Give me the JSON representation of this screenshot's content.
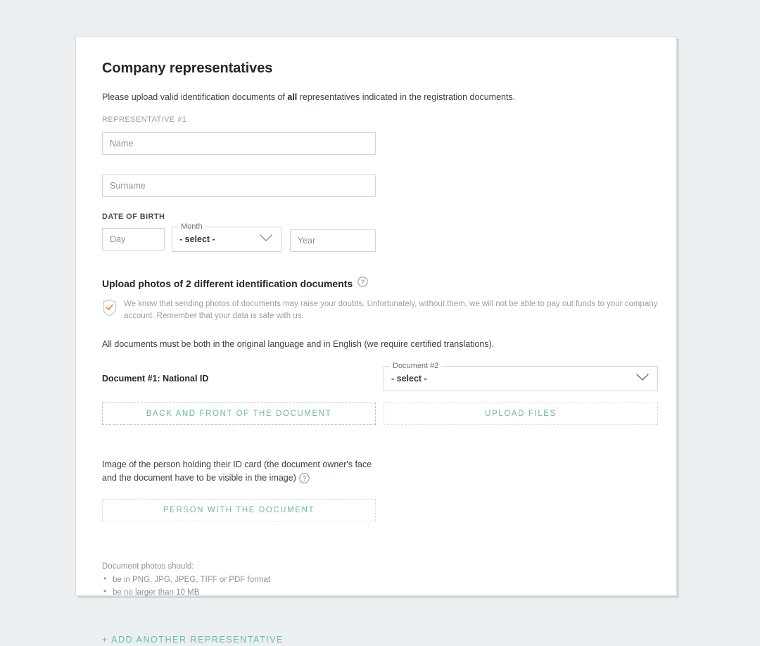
{
  "card": {
    "title": "Company representatives",
    "intro_before": "Please upload valid identification documents of ",
    "intro_bold": "all",
    "intro_after": " representatives indicated in the registration documents.",
    "representative_caption": "REPRESENTATIVE #1"
  },
  "form": {
    "name_placeholder": "Name",
    "surname_placeholder": "Surname",
    "dob_label": "DATE OF BIRTH",
    "day_placeholder": "Day",
    "month_legend": "Month",
    "month_value": "- select -",
    "year_placeholder": "Year"
  },
  "upload": {
    "heading": "Upload photos of 2 different identification documents",
    "help_icon": "question-circle-icon",
    "notice_icon": "shield-check-icon",
    "notice_text": "We know that sending photos of documents may raise your doubts. Unfortunately, without them, we will not be able to pay out funds to your company account. Remember that your data is safe with us.",
    "translations_text": "All documents must be both in the original language and in English (we require certified translations)."
  },
  "documents": {
    "doc1_label": "Document #1: National ID",
    "doc2_legend": "Document #2",
    "doc2_value": "- select -",
    "btn_back_front": "BACK AND FRONT OF THE DOCUMENT",
    "btn_upload_files": "UPLOAD FILES"
  },
  "person": {
    "description": "Image of the person holding their ID card (the document owner's face and the document have to be visible in the image)",
    "help_icon": "question-circle-icon",
    "btn_label": "PERSON WITH THE DOCUMENT"
  },
  "footnotes": {
    "intro": "Document photos should:",
    "items": [
      "be in PNG, JPG, JPEG, TIFF or PDF format",
      "be no larger than 10 MB"
    ]
  },
  "actions": {
    "add_representative": "+ ADD ANOTHER REPRESENTATIVE"
  },
  "colors": {
    "accent": "#6bbaa0",
    "page_bg": "#eceff1",
    "card_bg": "#ffffff",
    "shield_check": "#ef8b33",
    "text_primary": "#23282b",
    "text_muted": "#9aa0a4"
  }
}
